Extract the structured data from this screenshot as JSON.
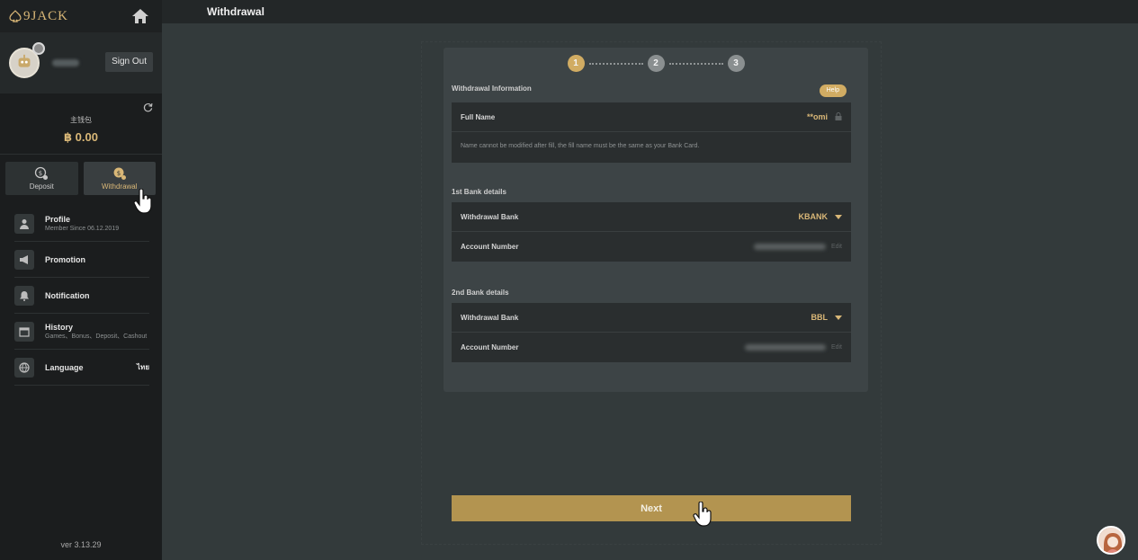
{
  "brand": {
    "logo_text": "9JACK"
  },
  "user": {
    "sign_out_label": "Sign Out"
  },
  "wallet": {
    "label": "主钱包",
    "amount": "฿ 0.00"
  },
  "actions": {
    "deposit_label": "Deposit",
    "withdrawal_label": "Withdrawal"
  },
  "menu": {
    "profile": {
      "title": "Profile",
      "sub": "Member Since 06.12.2019"
    },
    "promotion": {
      "title": "Promotion"
    },
    "notification": {
      "title": "Notification"
    },
    "history": {
      "title": "History",
      "sub": "Games、Bonus、Deposit、Cashout"
    },
    "language": {
      "title": "Language",
      "value": "ไทย"
    }
  },
  "version": "ver 3.13.29",
  "page": {
    "title": "Withdrawal"
  },
  "steps": [
    "1",
    "2",
    "3"
  ],
  "form": {
    "info_title": "Withdrawal Information",
    "help_label": "Help",
    "full_name_label": "Full Name",
    "full_name_value": "**omi",
    "name_note": "Name cannot be modified after fill, the fill name must be the same as your Bank Card.",
    "bank1_title": "1st Bank details",
    "bank1_bank_label": "Withdrawal Bank",
    "bank1_bank_value": "KBANK",
    "bank1_account_label": "Account Number",
    "bank1_edit": "Edit",
    "bank2_title": "2nd Bank details",
    "bank2_bank_label": "Withdrawal Bank",
    "bank2_bank_value": "BBL",
    "bank2_account_label": "Account Number",
    "bank2_edit": "Edit",
    "next_label": "Next"
  },
  "colors": {
    "accent": "#d1ac63",
    "button": "#b39450",
    "sidebar": "#1b1d1e",
    "main": "#333a3b"
  }
}
